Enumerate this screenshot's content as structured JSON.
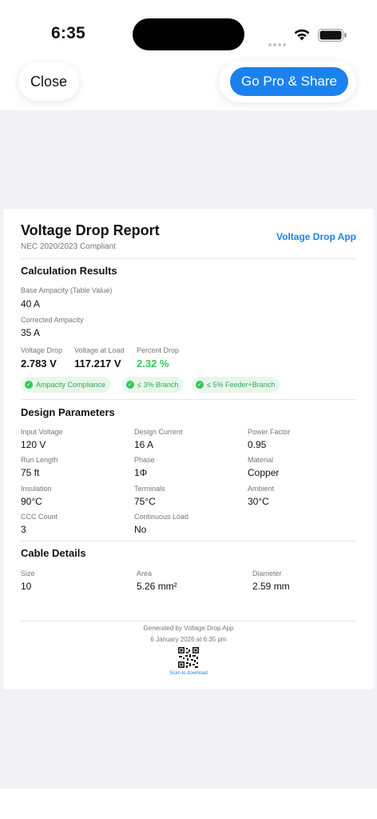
{
  "status": {
    "time": "6:35"
  },
  "nav": {
    "close_label": "Close",
    "pro_label": "Go Pro & Share"
  },
  "report": {
    "title": "Voltage Drop Report",
    "subtitle": "NEC 2020/2023 Compliant",
    "app_name": "Voltage Drop App",
    "calc": {
      "heading": "Calculation Results",
      "base_ampacity_label": "Base Ampacity (Table Value)",
      "base_ampacity_value": "40 A",
      "corrected_ampacity_label": "Corrected Ampacity",
      "corrected_ampacity_value": "35 A",
      "voltage_drop_label": "Voltage Drop",
      "voltage_drop_value": "2.783 V",
      "voltage_at_load_label": "Voltage at Load",
      "voltage_at_load_value": "117.217 V",
      "percent_drop_label": "Percent Drop",
      "percent_drop_value": "2.32 %",
      "badges": [
        "Ampacity Compliance",
        "≤ 3% Branch",
        "≤ 5% Feeder+Branch"
      ]
    },
    "design": {
      "heading": "Design Parameters",
      "params": [
        {
          "label": "Input Voltage",
          "value": "120 V"
        },
        {
          "label": "Design Current",
          "value": "16 A"
        },
        {
          "label": "Power Factor",
          "value": "0.95"
        },
        {
          "label": "Run Length",
          "value": "75 ft"
        },
        {
          "label": "Phase",
          "value": "1Φ"
        },
        {
          "label": "Material",
          "value": "Copper"
        },
        {
          "label": "Insulation",
          "value": "90°C"
        },
        {
          "label": "Terminals",
          "value": "75°C"
        },
        {
          "label": "Ambient",
          "value": "30°C"
        },
        {
          "label": "CCC Count",
          "value": "3"
        },
        {
          "label": "Continuous Load",
          "value": "No"
        }
      ]
    },
    "cable": {
      "heading": "Cable Details",
      "size_label": "Size",
      "size_value": "10",
      "area_label": "Area",
      "area_value": "5.26 mm²",
      "diameter_label": "Diameter",
      "diameter_value": "2.59 mm"
    },
    "footer": {
      "generated": "Generated by Voltage Drop App",
      "date": "6 January 2026 at 6:35 pm",
      "scan": "Scan to download"
    }
  },
  "colors": {
    "accent": "#1a82ef",
    "success": "#34c759",
    "background": "#f1f1f6"
  }
}
